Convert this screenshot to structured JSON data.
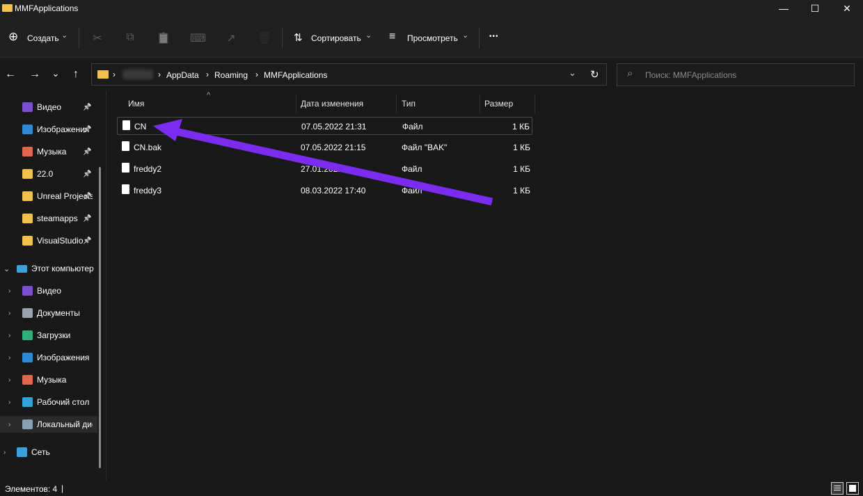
{
  "window": {
    "title": "MMFApplications",
    "controls": {
      "minimize": "—",
      "maximize": "☐",
      "close": "✕"
    }
  },
  "toolbar": {
    "new_icon": "⊕",
    "new_label": "Создать",
    "cut_icon": "✂",
    "copy_icon": "⧉",
    "paste_icon": "📋",
    "rename_icon": "⌨",
    "share_icon": "↗",
    "delete_icon": "🗑",
    "sort_icon": "⇅",
    "sort_label": "Сортировать",
    "view_icon": "≡",
    "view_label": "Просмотреть",
    "more_label": "•••",
    "chevron": "⌄"
  },
  "nav": {
    "back": "←",
    "forward": "→",
    "recent": "⌄",
    "up": "↑"
  },
  "address": {
    "crumbs": [
      "AppData",
      "Roaming",
      "MMFApplications"
    ],
    "separator": "›",
    "dropdown": "⌄",
    "refresh": "↻"
  },
  "search": {
    "icon": "⌕",
    "placeholder": "Поиск: MMFApplications"
  },
  "sidebar": {
    "quick": [
      {
        "label": "Видео",
        "icon": "video-icon",
        "color": "#7b4fd1"
      },
      {
        "label": "Изображения",
        "icon": "pictures-icon",
        "color": "#2e8ad8"
      },
      {
        "label": "Музыка",
        "icon": "music-icon",
        "color": "#e0674f"
      },
      {
        "label": "22.0",
        "icon": "folder-icon",
        "color": "#f2c04c"
      },
      {
        "label": "Unreal Projects",
        "icon": "folder-icon",
        "color": "#f2c04c"
      },
      {
        "label": "steamapps",
        "icon": "folder-icon",
        "color": "#f2c04c"
      },
      {
        "label": "VisualStudio",
        "icon": "folder-icon",
        "color": "#f2c04c"
      }
    ],
    "pin": "📌",
    "computer": {
      "label": "Этот компьютер",
      "chevron": "⌄"
    },
    "computer_items": [
      {
        "label": "Видео",
        "icon": "video-icon",
        "color": "#7b4fd1"
      },
      {
        "label": "Документы",
        "icon": "documents-icon",
        "color": "#9aa4b0"
      },
      {
        "label": "Загрузки",
        "icon": "downloads-icon",
        "color": "#2fb07a"
      },
      {
        "label": "Изображения",
        "icon": "pictures-icon",
        "color": "#2e8ad8"
      },
      {
        "label": "Музыка",
        "icon": "music-icon",
        "color": "#e0674f"
      },
      {
        "label": "Рабочий стол",
        "icon": "desktop-icon",
        "color": "#31a3d8"
      },
      {
        "label": "Локальный диск",
        "icon": "drive-icon",
        "color": "#8aa0b5"
      }
    ],
    "network": {
      "label": "Сеть",
      "chevron": "›"
    },
    "item_chevron": "›"
  },
  "filelist": {
    "sort_arrow": "^",
    "columns": {
      "name": "Имя",
      "date": "Дата изменения",
      "type": "Тип",
      "size": "Размер"
    },
    "rows": [
      {
        "name": "CN",
        "date": "07.05.2022 21:31",
        "type": "Файл",
        "size": "1 КБ"
      },
      {
        "name": "CN.bak",
        "date": "07.05.2022 21:15",
        "type": "Файл \"BAK\"",
        "size": "1 КБ"
      },
      {
        "name": "freddy2",
        "date": "27.01.2022 ",
        "type": "Файл",
        "size": "1 КБ"
      },
      {
        "name": "freddy3",
        "date": "08.03.2022 17:40",
        "type": "Файл",
        "size": "1 КБ"
      }
    ],
    "selected_index": 0
  },
  "annotation": {
    "arrow_color": "#7a2cf0"
  },
  "status": {
    "items_text": "Элементов: 4",
    "cursor": "|"
  }
}
